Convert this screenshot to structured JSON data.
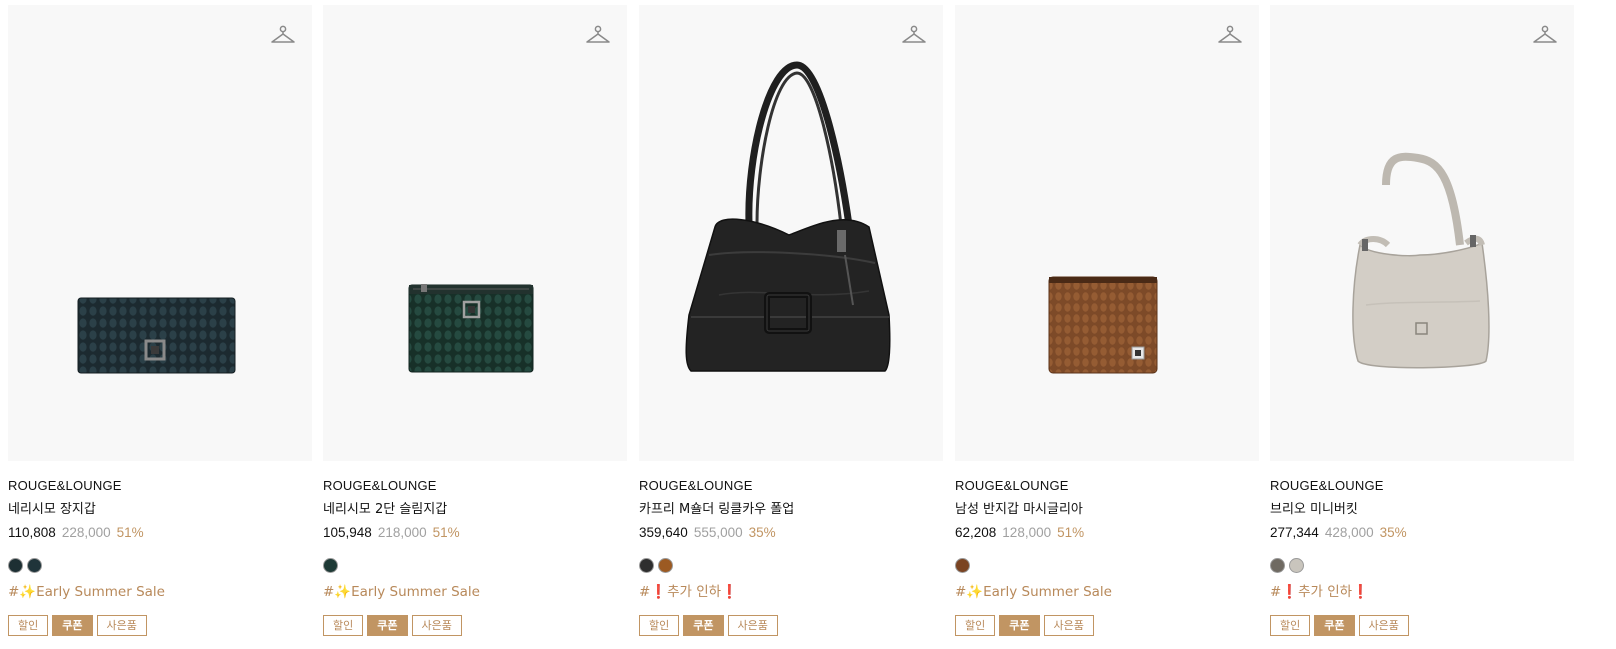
{
  "products": [
    {
      "brand": "ROUGE&LOUNGE",
      "name": "네리시모 장지갑",
      "price": "110,808",
      "original_price": "228,000",
      "discount": "51%",
      "swatches": [
        "#1d2f33",
        "#1f343a"
      ],
      "tag": "#✨Early Summer Sale",
      "badges": [
        "할인",
        "쿠폰",
        "사은품"
      ],
      "icon": "hanger-icon",
      "image": "long-wallet-quilted-teal"
    },
    {
      "brand": "ROUGE&LOUNGE",
      "name": "네리시모 2단 슬림지갑",
      "price": "105,948",
      "original_price": "218,000",
      "discount": "51%",
      "swatches": [
        "#1e3a36"
      ],
      "tag": "#✨Early Summer Sale",
      "badges": [
        "할인",
        "쿠폰",
        "사은품"
      ],
      "icon": "hanger-icon",
      "image": "slim-wallet-quilted-green"
    },
    {
      "brand": "ROUGE&LOUNGE",
      "name": "카프리 M숄더 링클카우 폴업",
      "price": "359,640",
      "original_price": "555,000",
      "discount": "35%",
      "swatches": [
        "#2e2e2e",
        "#9c5a22"
      ],
      "tag": "#❗추가 인하❗",
      "badges": [
        "할인",
        "쿠폰",
        "사은품"
      ],
      "icon": "hanger-icon",
      "image": "shoulder-bag-black-leather"
    },
    {
      "brand": "ROUGE&LOUNGE",
      "name": "남성 반지갑 마시글리아",
      "price": "62,208",
      "original_price": "128,000",
      "discount": "51%",
      "swatches": [
        "#7a4422"
      ],
      "tag": "#✨Early Summer Sale",
      "badges": [
        "할인",
        "쿠폰",
        "사은품"
      ],
      "icon": "hanger-icon",
      "image": "bifold-wallet-brown"
    },
    {
      "brand": "ROUGE&LOUNGE",
      "name": "브리오 미니버킷",
      "price": "277,344",
      "original_price": "428,000",
      "discount": "35%",
      "swatches": [
        "#6f6a62",
        "#c9c5bd"
      ],
      "tag": "#❗추가 인하❗",
      "badges": [
        "할인",
        "쿠폰",
        "사은품"
      ],
      "icon": "hanger-icon",
      "image": "mini-bucket-bag-grey"
    }
  ],
  "colors": {
    "accent": "#c19563",
    "tag_text": "#b8895a",
    "original_price": "#a0a0a0",
    "image_bg": "#f8f8f8"
  }
}
